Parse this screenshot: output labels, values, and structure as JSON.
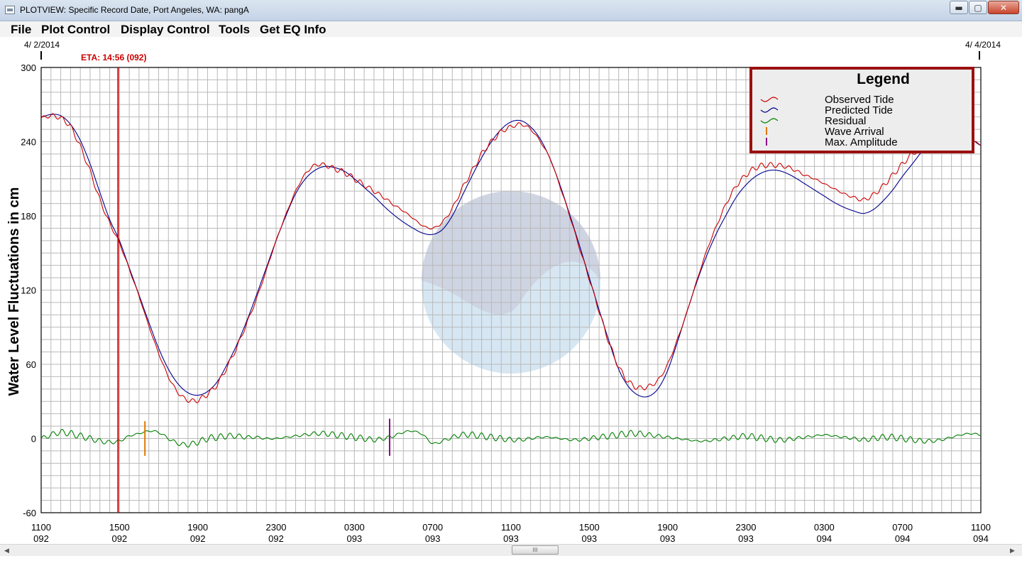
{
  "window": {
    "title": "PLOTVIEW: Specific Record Date, Port Angeles, WA: pangA",
    "buttons": {
      "minimize": "▬",
      "maximize": "▢",
      "close": "✕"
    }
  },
  "menu": [
    "File",
    "Plot Control",
    "Display Control",
    "Tools",
    "Get EQ Info"
  ],
  "scrollbar": {
    "thumb_label": "III"
  },
  "colors": {
    "observed": "#cc0000",
    "predicted": "#00008b",
    "residual": "#008000",
    "wave_arrival": "#e07800",
    "max_amplitude": "#8b008b",
    "eta_line": "#cc0000",
    "grid": "#b9b9b9",
    "legend_border": "#9b1010"
  },
  "chart_data": {
    "type": "line",
    "ylabel": "Water Level Fluctuations in cm",
    "ylim": [
      -60,
      300
    ],
    "yticks": [
      -60,
      0,
      60,
      120,
      180,
      240,
      300
    ],
    "x_unit": "hours from 4/2/2014 11:00 UTC",
    "xlim": [
      0,
      48
    ],
    "xticks": [
      {
        "x": 0,
        "time": "1100",
        "day": "092"
      },
      {
        "x": 4,
        "time": "1500",
        "day": "092"
      },
      {
        "x": 8,
        "time": "1900",
        "day": "092"
      },
      {
        "x": 12,
        "time": "2300",
        "day": "092"
      },
      {
        "x": 16,
        "time": "0300",
        "day": "093"
      },
      {
        "x": 20,
        "time": "0700",
        "day": "093"
      },
      {
        "x": 24,
        "time": "1100",
        "day": "093"
      },
      {
        "x": 28,
        "time": "1500",
        "day": "093"
      },
      {
        "x": 32,
        "time": "1900",
        "day": "093"
      },
      {
        "x": 36,
        "time": "2300",
        "day": "093"
      },
      {
        "x": 40,
        "time": "0300",
        "day": "094"
      },
      {
        "x": 44,
        "time": "0700",
        "day": "094"
      },
      {
        "x": 48,
        "time": "1100",
        "day": "094"
      }
    ],
    "date_start": "4/ 2/2014",
    "date_end": "4/ 4/2014",
    "eta": {
      "label": "ETA: 14:56 (092)",
      "x": 3.93
    },
    "wave_arrival_x": 5.3,
    "max_amplitude_x": 17.8,
    "legend": {
      "title": "Legend",
      "entries": [
        "Observed Tide",
        "Predicted Tide",
        "Residual",
        "Wave Arrival",
        "Max. Amplitude"
      ]
    },
    "series": [
      {
        "name": "Predicted Tide",
        "x": [
          0,
          0.5,
          1,
          1.5,
          2,
          2.5,
          3,
          3.5,
          4,
          4.5,
          5,
          5.5,
          6,
          6.5,
          7,
          7.5,
          8,
          8.5,
          9,
          9.5,
          10,
          10.5,
          11,
          11.5,
          12,
          12.5,
          13,
          13.5,
          14,
          14.5,
          15,
          15.5,
          16,
          16.5,
          17,
          17.5,
          18,
          18.5,
          19,
          19.5,
          20,
          20.5,
          21,
          21.5,
          22,
          22.5,
          23,
          23.5,
          24,
          24.5,
          25,
          25.5,
          26,
          26.5,
          27,
          27.5,
          28,
          28.5,
          29,
          29.5,
          30,
          30.5,
          31,
          31.5,
          32,
          32.5,
          33,
          33.5,
          34,
          34.5,
          35,
          35.5,
          36,
          36.5,
          37,
          37.5,
          38,
          38.5,
          39,
          39.5,
          40,
          40.5,
          41,
          41.5,
          42,
          42.5,
          43,
          43.5,
          44,
          44.5,
          45,
          45.5,
          46,
          46.5,
          47,
          47.5,
          48
        ],
        "values": [
          260,
          262,
          261,
          254,
          241,
          222,
          199,
          177,
          160,
          138,
          116,
          94,
          73,
          56,
          44,
          37,
          35,
          38,
          46,
          60,
          76,
          95,
          116,
          138,
          160,
          180,
          198,
          210,
          217,
          220,
          219,
          216,
          210,
          203,
          196,
          188,
          181,
          175,
          170,
          166,
          165,
          169,
          180,
          196,
          212,
          227,
          240,
          250,
          256,
          257,
          252,
          242,
          226,
          205,
          181,
          156,
          130,
          104,
          79,
          56,
          42,
          35,
          34,
          40,
          55,
          78,
          103,
          127,
          148,
          166,
          181,
          195,
          205,
          212,
          216,
          217,
          215,
          211,
          206,
          201,
          196,
          191,
          187,
          184,
          182,
          185,
          192,
          201,
          212,
          222,
          232,
          238,
          242,
          244,
          243,
          242,
          237
        ]
      },
      {
        "name": "Observed Tide",
        "x": [
          0,
          0.5,
          1,
          1.5,
          2,
          2.5,
          3,
          3.5,
          4,
          4.5,
          5,
          5.5,
          6,
          6.5,
          7,
          7.5,
          8,
          8.5,
          9,
          9.5,
          10,
          10.5,
          11,
          11.5,
          12,
          12.5,
          13,
          13.5,
          14,
          14.5,
          15,
          15.5,
          16,
          16.5,
          17,
          17.5,
          18,
          18.5,
          19,
          19.5,
          20,
          20.5,
          21,
          21.5,
          22,
          22.5,
          23,
          23.5,
          24,
          24.5,
          25,
          25.5,
          26,
          26.5,
          27,
          27.5,
          28,
          28.5,
          29,
          29.5,
          30,
          30.5,
          31,
          31.5,
          32,
          32.5,
          33,
          33.5,
          34,
          34.5,
          35,
          35.5,
          36,
          36.5,
          37,
          37.5,
          38,
          38.5,
          39,
          39.5,
          40,
          40.5,
          41,
          41.5,
          42,
          42.5,
          43,
          43.5,
          44,
          44.5,
          45,
          45.5,
          46,
          46.5,
          47,
          47.5,
          48
        ],
        "values": [
          259,
          261,
          259,
          252,
          236,
          216,
          193,
          174,
          158,
          137,
          115,
          91,
          69,
          50,
          37,
          31,
          31,
          36,
          44,
          58,
          74,
          93,
          113,
          136,
          160,
          181,
          200,
          214,
          221,
          221,
          218,
          215,
          210,
          205,
          200,
          195,
          189,
          184,
          178,
          172,
          170,
          175,
          186,
          202,
          216,
          230,
          240,
          248,
          252,
          254,
          250,
          240,
          226,
          204,
          180,
          154,
          129,
          103,
          78,
          58,
          46,
          41,
          42,
          47,
          60,
          80,
          103,
          128,
          152,
          172,
          190,
          204,
          213,
          219,
          221,
          221,
          220,
          217,
          213,
          210,
          206,
          202,
          198,
          195,
          193,
          197,
          204,
          213,
          222,
          230,
          235,
          239,
          241,
          243,
          242,
          241,
          238
        ]
      },
      {
        "name": "Residual",
        "x": [
          0,
          0.5,
          1,
          1.5,
          2,
          2.5,
          3,
          3.5,
          4,
          4.5,
          5,
          5.5,
          6,
          6.5,
          7,
          7.5,
          8,
          8.5,
          9,
          9.5,
          10,
          10.5,
          11,
          11.5,
          12,
          12.5,
          13,
          13.5,
          14,
          14.5,
          15,
          15.5,
          16,
          16.5,
          17,
          17.5,
          18,
          18.5,
          19,
          19.5,
          20,
          20.5,
          21,
          21.5,
          22,
          22.5,
          23,
          23.5,
          24,
          24.5,
          25,
          25.5,
          26,
          26.5,
          27,
          27.5,
          28,
          28.5,
          29,
          29.5,
          30,
          30.5,
          31,
          31.5,
          32,
          32.5,
          33,
          33.5,
          34,
          34.5,
          35,
          35.5,
          36,
          36.5,
          37,
          37.5,
          38,
          38.5,
          39,
          39.5,
          40,
          40.5,
          41,
          41.5,
          42,
          42.5,
          43,
          43.5,
          44,
          44.5,
          45,
          45.5,
          46,
          46.5,
          47,
          47.5,
          48
        ],
        "values": [
          0,
          3,
          5,
          4,
          2,
          0,
          -2,
          -3,
          -2,
          2,
          4,
          6,
          5,
          0,
          -4,
          -5,
          -3,
          0,
          1,
          2,
          2,
          1,
          1,
          0,
          0,
          1,
          2,
          3,
          4,
          4,
          3,
          2,
          1,
          0,
          -1,
          0,
          2,
          5,
          6,
          3,
          -4,
          -2,
          1,
          3,
          3,
          2,
          1,
          0,
          -1,
          -1,
          0,
          1,
          1,
          0,
          -1,
          -1,
          0,
          1,
          2,
          3,
          4,
          4,
          3,
          2,
          1,
          0,
          -1,
          -2,
          -2,
          -1,
          0,
          1,
          2,
          1,
          0,
          -1,
          -1,
          0,
          1,
          2,
          3,
          2,
          1,
          0,
          -1,
          0,
          1,
          1,
          0,
          -1,
          -2,
          -2,
          -1,
          1,
          3,
          4,
          3
        ]
      }
    ]
  }
}
